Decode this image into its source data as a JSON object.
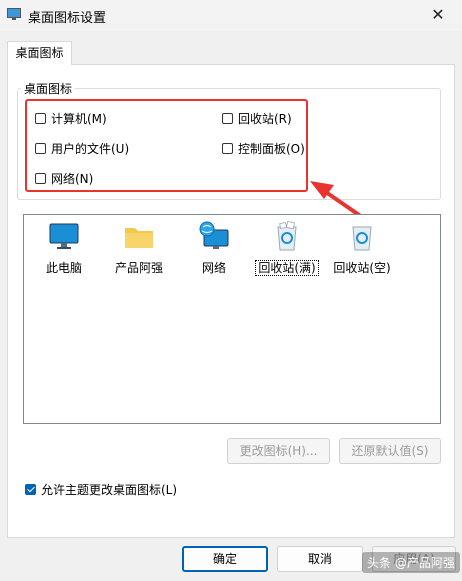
{
  "window": {
    "title": "桌面图标设置",
    "close_glyph": "✕"
  },
  "tab": {
    "label": "桌面图标"
  },
  "group": {
    "label": "桌面图标",
    "checkboxes": [
      {
        "label": "计算机(M)",
        "checked": false
      },
      {
        "label": "回收站(R)",
        "checked": false
      },
      {
        "label": "用户的文件(U)",
        "checked": false
      },
      {
        "label": "控制面板(O)",
        "checked": false
      },
      {
        "label": "网络(N)",
        "checked": false
      }
    ]
  },
  "icons": [
    {
      "label": "此电脑",
      "icon": "monitor-icon"
    },
    {
      "label": "产品阿强",
      "icon": "folder-icon"
    },
    {
      "label": "网络",
      "icon": "network-globe-icon"
    },
    {
      "label": "回收站(满)",
      "icon": "recycle-bin-full-icon",
      "selected": true
    },
    {
      "label": "回收站(空)",
      "icon": "recycle-bin-empty-icon"
    }
  ],
  "buttons": {
    "change_icon": "更改图标(H)...",
    "restore_default": "还原默认值(S)",
    "ok": "确定",
    "cancel": "取消",
    "apply": "应用(A)"
  },
  "allow_themes": {
    "label": "允许主题更改桌面图标(L)",
    "checked": true
  },
  "watermark": "头条 @产品阿强",
  "colors": {
    "annotation_red": "#e8342f",
    "accent_blue": "#0063b1"
  }
}
